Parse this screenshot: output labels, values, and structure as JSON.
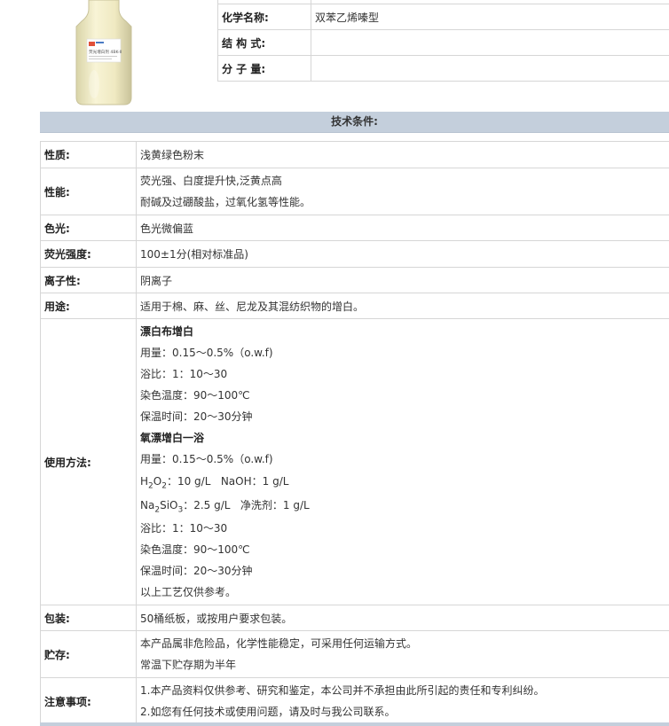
{
  "product": {
    "bottle_label": "荧光增白剂 4BK-II"
  },
  "info": [
    {
      "key": "化学名称:",
      "value": "双苯乙烯嗪型"
    },
    {
      "key": "结 构 式:",
      "value": ""
    },
    {
      "key": "分 子 量:",
      "value": ""
    }
  ],
  "tech_header": "技术条件:",
  "specs": {
    "appearance": {
      "key": "性质:",
      "value": "浅黄绿色粉末"
    },
    "performance": {
      "key": "性能:",
      "lines": [
        "荧光强、白度提升快,泛黄点高",
        "耐碱及过硼酸盐，过氧化氢等性能。"
      ]
    },
    "shade": {
      "key": "色光:",
      "value": "色光微偏蓝"
    },
    "strength": {
      "key": "荧光强度:",
      "value": "100±1分(相对标准品)"
    },
    "ionic": {
      "key": "离子性:",
      "value": "阴离子"
    },
    "usage": {
      "key": "用途:",
      "value": "适用于棉、麻、丝、尼龙及其混纺织物的增白。"
    },
    "method": {
      "key": "使用方法:",
      "section1_title": "漂白布增白",
      "section1_lines": [
        "用量：0.15～0.5%（o.w.f)",
        "浴比：1：10～30",
        "染色温度：90～100℃",
        "保温时间：20～30分钟"
      ],
      "section2_title": "氧漂增白一浴",
      "section2_dosage": "用量：0.15～0.5%（o.w.f)",
      "h2o2_h": "H",
      "h2o2_sub1": "2",
      "h2o2_o": "O",
      "h2o2_sub2": "2",
      "h2o2_rest": "：10 g/L   NaOH：1 g/L",
      "na_na": "Na",
      "na_sub1": "2",
      "na_sio": "SiO",
      "na_sub2": "3",
      "na_rest": "：2.5 g/L   净洗剂：1 g/L",
      "section2_lines": [
        "浴比：1：10～30",
        "染色温度：90～100℃",
        "保温时间：20～30分钟",
        "以上工艺仅供参考。"
      ]
    },
    "packing": {
      "key": "包装:",
      "value": "50桶纸板，或按用户要求包装。"
    },
    "storage": {
      "key": "贮存:",
      "lines": [
        "本产品属非危险品，化学性能稳定，可采用任何运输方式。",
        "常温下贮存期为半年"
      ]
    },
    "notes": {
      "key": "注意事项:",
      "lines": [
        "1.本产品资料仅供参考、研究和鉴定，本公司并不承担由此所引起的责任和专利纠纷。",
        "2.如您有任何技术或使用问题，请及时与我公司联系。"
      ]
    }
  },
  "colors": {
    "header_bg": "#c4cfdc",
    "border": "#d6d6d6",
    "powder": "#f3eec0"
  }
}
